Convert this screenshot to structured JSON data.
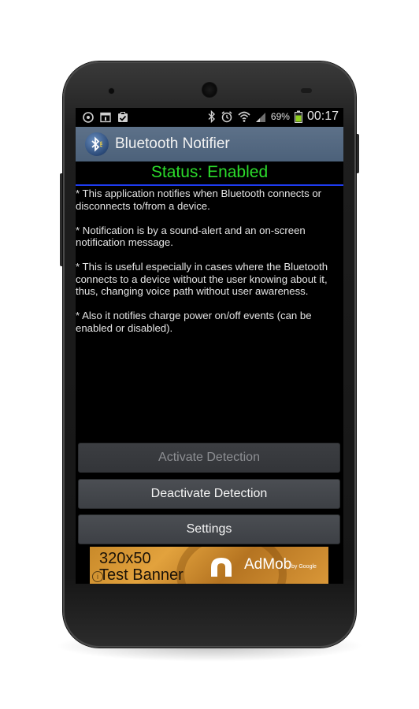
{
  "status_bar": {
    "battery_percent": "69%",
    "time": "00:17",
    "left_icons": [
      "alarm-clock-icon",
      "calendar-icon",
      "clipboard-check-icon"
    ],
    "right_icons": [
      "bluetooth-icon",
      "alarm-icon",
      "wifi-icon",
      "signal-icon",
      "battery-icon"
    ]
  },
  "action_bar": {
    "title": "Bluetooth Notifier",
    "icon": "bluetooth-app-icon"
  },
  "status": {
    "text": "Status: Enabled",
    "color": "#2bdc2b"
  },
  "description": [
    "* This application notifies when Bluetooth connects or disconnects to/from a device.",
    "* Notification is by a sound-alert and an on-screen notification message.",
    "* This is useful especially in cases where the Bluetooth connects to a device without the user knowing about it, thus, changing voice path without user awareness.",
    "* Also it notifies charge power on/off events (can be enabled or disabled)."
  ],
  "buttons": {
    "activate": {
      "label": "Activate Detection",
      "enabled": false
    },
    "deactivate": {
      "label": "Deactivate Detection",
      "enabled": true
    },
    "settings": {
      "label": "Settings",
      "enabled": true
    }
  },
  "ad_banner": {
    "size_text": "320x50",
    "test_text": "Test Banner",
    "brand": "AdMob",
    "by_google": "by Google",
    "info_glyph": "i"
  },
  "colors": {
    "action_bar": "#4c617a",
    "divider": "#1e3cf0",
    "background": "#000000"
  }
}
